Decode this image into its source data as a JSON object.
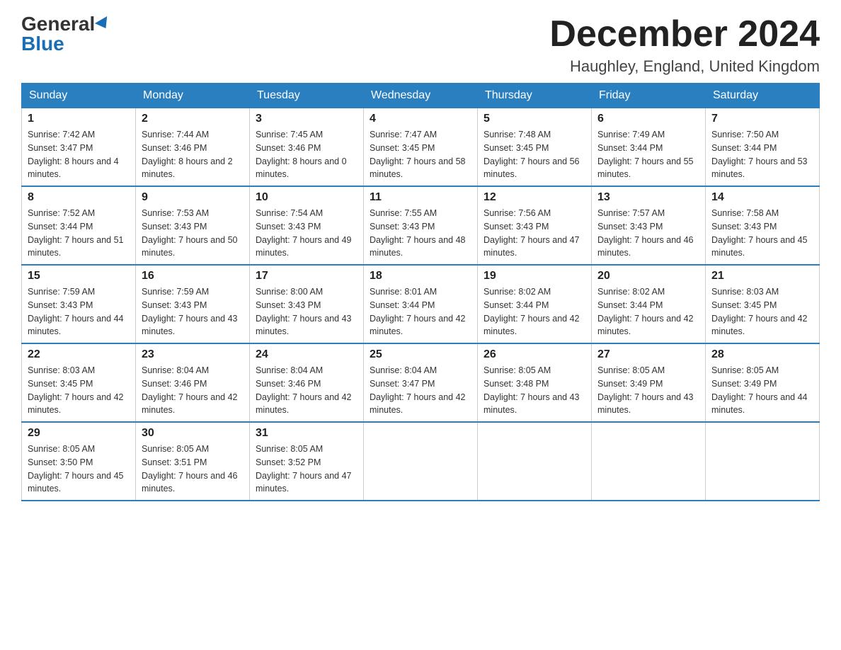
{
  "header": {
    "logo_general": "General",
    "logo_blue": "Blue",
    "month_title": "December 2024",
    "location": "Haughley, England, United Kingdom"
  },
  "days_of_week": [
    "Sunday",
    "Monday",
    "Tuesday",
    "Wednesday",
    "Thursday",
    "Friday",
    "Saturday"
  ],
  "weeks": [
    [
      {
        "day": "1",
        "sunrise": "7:42 AM",
        "sunset": "3:47 PM",
        "daylight": "8 hours and 4 minutes."
      },
      {
        "day": "2",
        "sunrise": "7:44 AM",
        "sunset": "3:46 PM",
        "daylight": "8 hours and 2 minutes."
      },
      {
        "day": "3",
        "sunrise": "7:45 AM",
        "sunset": "3:46 PM",
        "daylight": "8 hours and 0 minutes."
      },
      {
        "day": "4",
        "sunrise": "7:47 AM",
        "sunset": "3:45 PM",
        "daylight": "7 hours and 58 minutes."
      },
      {
        "day": "5",
        "sunrise": "7:48 AM",
        "sunset": "3:45 PM",
        "daylight": "7 hours and 56 minutes."
      },
      {
        "day": "6",
        "sunrise": "7:49 AM",
        "sunset": "3:44 PM",
        "daylight": "7 hours and 55 minutes."
      },
      {
        "day": "7",
        "sunrise": "7:50 AM",
        "sunset": "3:44 PM",
        "daylight": "7 hours and 53 minutes."
      }
    ],
    [
      {
        "day": "8",
        "sunrise": "7:52 AM",
        "sunset": "3:44 PM",
        "daylight": "7 hours and 51 minutes."
      },
      {
        "day": "9",
        "sunrise": "7:53 AM",
        "sunset": "3:43 PM",
        "daylight": "7 hours and 50 minutes."
      },
      {
        "day": "10",
        "sunrise": "7:54 AM",
        "sunset": "3:43 PM",
        "daylight": "7 hours and 49 minutes."
      },
      {
        "day": "11",
        "sunrise": "7:55 AM",
        "sunset": "3:43 PM",
        "daylight": "7 hours and 48 minutes."
      },
      {
        "day": "12",
        "sunrise": "7:56 AM",
        "sunset": "3:43 PM",
        "daylight": "7 hours and 47 minutes."
      },
      {
        "day": "13",
        "sunrise": "7:57 AM",
        "sunset": "3:43 PM",
        "daylight": "7 hours and 46 minutes."
      },
      {
        "day": "14",
        "sunrise": "7:58 AM",
        "sunset": "3:43 PM",
        "daylight": "7 hours and 45 minutes."
      }
    ],
    [
      {
        "day": "15",
        "sunrise": "7:59 AM",
        "sunset": "3:43 PM",
        "daylight": "7 hours and 44 minutes."
      },
      {
        "day": "16",
        "sunrise": "7:59 AM",
        "sunset": "3:43 PM",
        "daylight": "7 hours and 43 minutes."
      },
      {
        "day": "17",
        "sunrise": "8:00 AM",
        "sunset": "3:43 PM",
        "daylight": "7 hours and 43 minutes."
      },
      {
        "day": "18",
        "sunrise": "8:01 AM",
        "sunset": "3:44 PM",
        "daylight": "7 hours and 42 minutes."
      },
      {
        "day": "19",
        "sunrise": "8:02 AM",
        "sunset": "3:44 PM",
        "daylight": "7 hours and 42 minutes."
      },
      {
        "day": "20",
        "sunrise": "8:02 AM",
        "sunset": "3:44 PM",
        "daylight": "7 hours and 42 minutes."
      },
      {
        "day": "21",
        "sunrise": "8:03 AM",
        "sunset": "3:45 PM",
        "daylight": "7 hours and 42 minutes."
      }
    ],
    [
      {
        "day": "22",
        "sunrise": "8:03 AM",
        "sunset": "3:45 PM",
        "daylight": "7 hours and 42 minutes."
      },
      {
        "day": "23",
        "sunrise": "8:04 AM",
        "sunset": "3:46 PM",
        "daylight": "7 hours and 42 minutes."
      },
      {
        "day": "24",
        "sunrise": "8:04 AM",
        "sunset": "3:46 PM",
        "daylight": "7 hours and 42 minutes."
      },
      {
        "day": "25",
        "sunrise": "8:04 AM",
        "sunset": "3:47 PM",
        "daylight": "7 hours and 42 minutes."
      },
      {
        "day": "26",
        "sunrise": "8:05 AM",
        "sunset": "3:48 PM",
        "daylight": "7 hours and 43 minutes."
      },
      {
        "day": "27",
        "sunrise": "8:05 AM",
        "sunset": "3:49 PM",
        "daylight": "7 hours and 43 minutes."
      },
      {
        "day": "28",
        "sunrise": "8:05 AM",
        "sunset": "3:49 PM",
        "daylight": "7 hours and 44 minutes."
      }
    ],
    [
      {
        "day": "29",
        "sunrise": "8:05 AM",
        "sunset": "3:50 PM",
        "daylight": "7 hours and 45 minutes."
      },
      {
        "day": "30",
        "sunrise": "8:05 AM",
        "sunset": "3:51 PM",
        "daylight": "7 hours and 46 minutes."
      },
      {
        "day": "31",
        "sunrise": "8:05 AM",
        "sunset": "3:52 PM",
        "daylight": "7 hours and 47 minutes."
      },
      null,
      null,
      null,
      null
    ]
  ]
}
